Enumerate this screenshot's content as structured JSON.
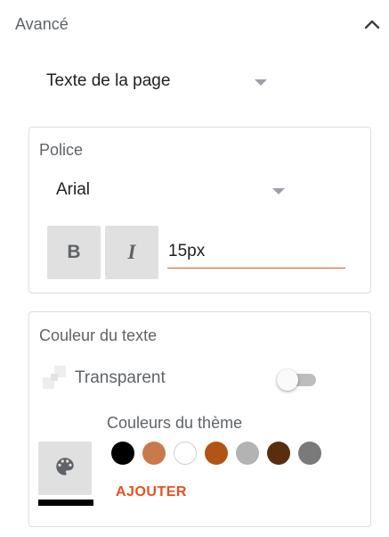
{
  "section": {
    "title": "Avancé"
  },
  "page_text_select": {
    "value": "Texte de la page"
  },
  "font_card": {
    "title": "Police",
    "font_value": "Arial",
    "bold_label": "B",
    "italic_label": "I",
    "size_value": "15px"
  },
  "color_card": {
    "title": "Couleur du texte",
    "transparent_label": "Transparent",
    "transparent_on": false,
    "theme_label": "Couleurs du thème",
    "theme_colors": [
      "#000000",
      "#c97a4a",
      "#ffffff",
      "#b15415",
      "#b3b3b3",
      "#5a2d0c",
      "#7a7a7a"
    ],
    "selected_color": "#000000",
    "add_label": "AJOUTER"
  },
  "icons": {
    "collapse": "chevron-up-icon",
    "dropdown": "caret-down-icon",
    "transparent": "transparent-checker-icon",
    "palette": "palette-icon"
  },
  "colors": {
    "accent": "#e8501f",
    "button_bg": "#e0e0e0",
    "muted_text": "#5f6368"
  }
}
